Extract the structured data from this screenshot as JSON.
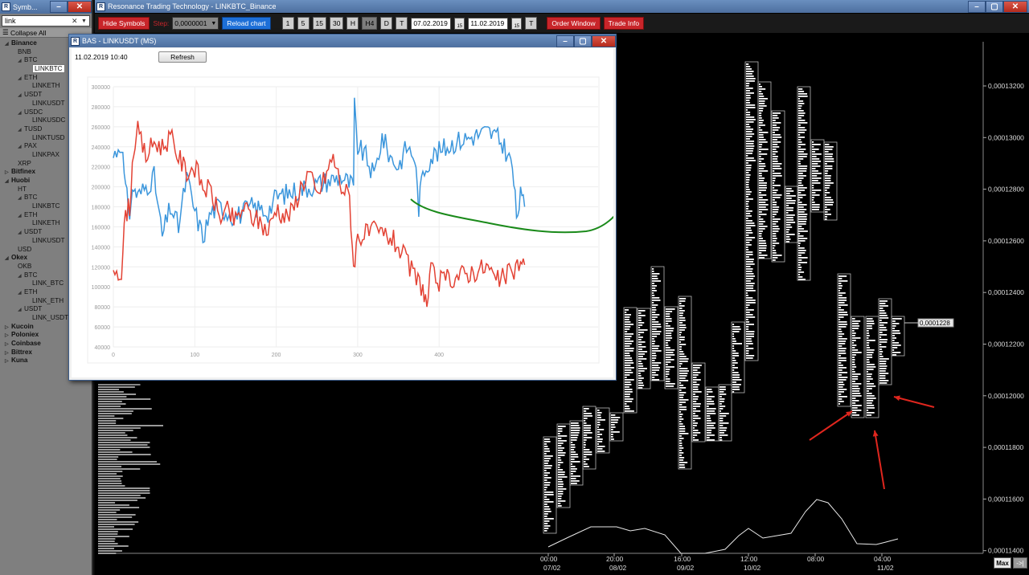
{
  "symbols_window": {
    "title": "Symb...",
    "search_value": "link",
    "collapse_label": "Collapse All",
    "tree": [
      {
        "label": "Binance",
        "level": 0,
        "arrow": "◢"
      },
      {
        "label": "BNB",
        "level": 1
      },
      {
        "label": "BTC",
        "level": 1,
        "arrow": "◢"
      },
      {
        "label": "LINKBTC",
        "level": 3,
        "selected": true
      },
      {
        "label": "ETH",
        "level": 1,
        "arrow": "◢"
      },
      {
        "label": "LINKETH",
        "level": 3
      },
      {
        "label": "USDT",
        "level": 1,
        "arrow": "◢"
      },
      {
        "label": "LINKUSDT",
        "level": 3
      },
      {
        "label": "USDC",
        "level": 1,
        "arrow": "◢"
      },
      {
        "label": "LINKUSDC",
        "level": 3
      },
      {
        "label": "TUSD",
        "level": 1,
        "arrow": "◢"
      },
      {
        "label": "LINKTUSD",
        "level": 3
      },
      {
        "label": "PAX",
        "level": 1,
        "arrow": "◢"
      },
      {
        "label": "LINKPAX",
        "level": 3
      },
      {
        "label": "XRP",
        "level": 1
      },
      {
        "label": "Bitfinex",
        "level": 0,
        "arrow": "▷"
      },
      {
        "label": "Huobi",
        "level": 0,
        "arrow": "◢"
      },
      {
        "label": "HT",
        "level": 1
      },
      {
        "label": "BTC",
        "level": 1,
        "arrow": "◢"
      },
      {
        "label": "LINKBTC",
        "level": 3
      },
      {
        "label": "ETH",
        "level": 1,
        "arrow": "◢"
      },
      {
        "label": "LINKETH",
        "level": 3
      },
      {
        "label": "USDT",
        "level": 1,
        "arrow": "◢"
      },
      {
        "label": "LINKUSDT",
        "level": 3
      },
      {
        "label": "USD",
        "level": 1
      },
      {
        "label": "Okex",
        "level": 0,
        "arrow": "◢"
      },
      {
        "label": "OKB",
        "level": 1
      },
      {
        "label": "BTC",
        "level": 1,
        "arrow": "◢"
      },
      {
        "label": "LINK_BTC",
        "level": 3
      },
      {
        "label": "ETH",
        "level": 1,
        "arrow": "◢"
      },
      {
        "label": "LINK_ETH",
        "level": 3
      },
      {
        "label": "USDT",
        "level": 1,
        "arrow": "◢"
      },
      {
        "label": "LINK_USDT",
        "level": 3
      },
      {
        "label": "Kucoin",
        "level": 0,
        "arrow": "▷"
      },
      {
        "label": "Poloniex",
        "level": 0,
        "arrow": "▷"
      },
      {
        "label": "Coinbase",
        "level": 0,
        "arrow": "▷"
      },
      {
        "label": "Bittrex",
        "level": 0,
        "arrow": "▷"
      },
      {
        "label": "Kuna",
        "level": 0,
        "arrow": "▷"
      }
    ]
  },
  "main_window": {
    "title": "Resonance Trading Technology - LINKBTC_Binance",
    "toolbar": {
      "hide_symbols": "Hide Symbols",
      "step_label": "Step:",
      "step_value": "0,0000001",
      "reload_chart": "Reload chart",
      "timeframes": [
        "1",
        "5",
        "15",
        "30",
        "H",
        "H4",
        "D",
        "T"
      ],
      "date_from": "07.02.2019",
      "date_to": "11.02.2019",
      "date_t": "T",
      "cal_label": "15",
      "order_window": "Order Window",
      "trade_info": "Trade Info"
    },
    "price_axis": [
      "0,00013200",
      "0,00013000",
      "0,00012800",
      "0,00012600",
      "0,00012400",
      "0,00012200",
      "0,00012000",
      "0,00011800",
      "0,00011600",
      "0,00011400"
    ],
    "current_price": "0,0001228",
    "time_axis": [
      {
        "time": "00:00",
        "date": "07/02"
      },
      {
        "time": "20:00",
        "date": "08/02"
      },
      {
        "time": "16:00",
        "date": "09/02"
      },
      {
        "time": "12:00",
        "date": "10/02"
      },
      {
        "time": "08:00",
        "date": ""
      },
      {
        "time": "04:00",
        "date": "11/02"
      }
    ],
    "max_button": "Max",
    "forward_button": "->|"
  },
  "bas_window": {
    "title": "BAS - LINKUSDT (MS)",
    "timestamp": "11.02.2019 10:40",
    "refresh": "Refresh"
  },
  "chart_data": {
    "type": "line",
    "x_ticks": [
      0,
      100,
      200,
      300,
      400
    ],
    "y_ticks": [
      40000,
      60000,
      80000,
      100000,
      120000,
      140000,
      160000,
      180000,
      200000,
      220000,
      240000,
      260000,
      280000,
      300000
    ],
    "xlim": [
      0,
      500
    ],
    "ylim": [
      40000,
      300000
    ],
    "grid": true,
    "series": [
      {
        "color": "#3b96dc",
        "values_anchor": [
          [
            0,
            230000
          ],
          [
            10,
            245000
          ],
          [
            15,
            195000
          ],
          [
            20,
            175000
          ],
          [
            25,
            200000
          ],
          [
            30,
            190000
          ],
          [
            40,
            200000
          ],
          [
            50,
            210000
          ],
          [
            60,
            150000
          ],
          [
            70,
            180000
          ],
          [
            80,
            160000
          ],
          [
            90,
            210000
          ],
          [
            100,
            175000
          ],
          [
            110,
            150000
          ],
          [
            120,
            175000
          ],
          [
            130,
            180000
          ],
          [
            150,
            170000
          ],
          [
            170,
            180000
          ],
          [
            190,
            175000
          ],
          [
            200,
            190000
          ],
          [
            220,
            195000
          ],
          [
            240,
            200000
          ],
          [
            260,
            205000
          ],
          [
            280,
            210000
          ],
          [
            295,
            200000
          ],
          [
            296,
            280000
          ],
          [
            300,
            240000
          ],
          [
            310,
            230000
          ],
          [
            320,
            210000
          ],
          [
            330,
            250000
          ],
          [
            340,
            230000
          ],
          [
            350,
            220000
          ],
          [
            360,
            240000
          ],
          [
            370,
            230000
          ],
          [
            375,
            180000
          ],
          [
            380,
            215000
          ],
          [
            390,
            230000
          ],
          [
            400,
            235000
          ],
          [
            420,
            245000
          ],
          [
            440,
            250000
          ],
          [
            460,
            255000
          ],
          [
            470,
            250000
          ],
          [
            480,
            240000
          ],
          [
            490,
            220000
          ],
          [
            495,
            170000
          ],
          [
            500,
            190000
          ],
          [
            505,
            180000
          ]
        ]
      },
      {
        "color": "#e34234",
        "values_anchor": [
          [
            0,
            120000
          ],
          [
            10,
            115000
          ],
          [
            15,
            175000
          ],
          [
            20,
            180000
          ],
          [
            25,
            240000
          ],
          [
            30,
            255000
          ],
          [
            40,
            230000
          ],
          [
            50,
            245000
          ],
          [
            60,
            240000
          ],
          [
            70,
            250000
          ],
          [
            80,
            230000
          ],
          [
            90,
            215000
          ],
          [
            100,
            220000
          ],
          [
            110,
            200000
          ],
          [
            120,
            195000
          ],
          [
            130,
            170000
          ],
          [
            140,
            175000
          ],
          [
            150,
            165000
          ],
          [
            160,
            180000
          ],
          [
            170,
            170000
          ],
          [
            180,
            165000
          ],
          [
            190,
            155000
          ],
          [
            200,
            180000
          ],
          [
            210,
            170000
          ],
          [
            220,
            175000
          ],
          [
            230,
            200000
          ],
          [
            240,
            215000
          ],
          [
            250,
            190000
          ],
          [
            260,
            210000
          ],
          [
            270,
            230000
          ],
          [
            280,
            200000
          ],
          [
            290,
            190000
          ],
          [
            295,
            120000
          ],
          [
            300,
            150000
          ],
          [
            320,
            155000
          ],
          [
            340,
            150000
          ],
          [
            350,
            140000
          ],
          [
            360,
            125000
          ],
          [
            370,
            110000
          ],
          [
            380,
            100000
          ],
          [
            385,
            80000
          ],
          [
            390,
            115000
          ],
          [
            400,
            105000
          ],
          [
            420,
            110000
          ],
          [
            440,
            115000
          ],
          [
            460,
            120000
          ],
          [
            470,
            105000
          ],
          [
            480,
            110000
          ],
          [
            490,
            115000
          ],
          [
            500,
            125000
          ],
          [
            505,
            122000
          ]
        ]
      }
    ]
  }
}
